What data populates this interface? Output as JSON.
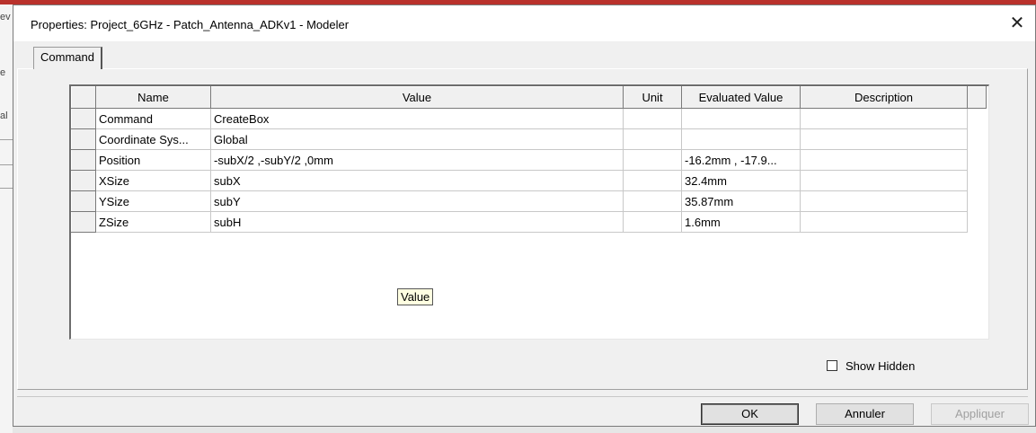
{
  "background": {
    "fragments": [
      "ev",
      "e",
      "al"
    ]
  },
  "dialog": {
    "title": "Properties: Project_6GHz - Patch_Antenna_ADKv1 - Modeler",
    "close_glyph": "✕",
    "tab_label": "Command",
    "columns": [
      "Name",
      "Value",
      "Unit",
      "Evaluated Value",
      "Description"
    ],
    "rows": [
      {
        "name": "Command",
        "value": "CreateBox",
        "unit": "",
        "evaluated": "",
        "description": ""
      },
      {
        "name": "Coordinate Sys...",
        "value": "Global",
        "unit": "",
        "evaluated": "",
        "description": ""
      },
      {
        "name": "Position",
        "value": "-subX/2 ,-subY/2 ,0mm",
        "unit": "",
        "evaluated": "-16.2mm , -17.9...",
        "description": ""
      },
      {
        "name": "XSize",
        "value": "subX",
        "unit": "",
        "evaluated": "32.4mm",
        "description": ""
      },
      {
        "name": "YSize",
        "value": "subY",
        "unit": "",
        "evaluated": "35.87mm",
        "description": ""
      },
      {
        "name": "ZSize",
        "value": "subH",
        "unit": "",
        "evaluated": "1.6mm",
        "description": ""
      }
    ],
    "tooltip": "Value",
    "show_hidden_label": "Show Hidden",
    "show_hidden_checked": false,
    "buttons": {
      "ok": "OK",
      "cancel": "Annuler",
      "apply": "Appliquer"
    }
  },
  "colors": {
    "titlebar": "#ffffff",
    "dialog_bg": "#f0f0f0",
    "tooltip_bg": "#ffffe1",
    "disabled_text": "#a0a0a0"
  }
}
